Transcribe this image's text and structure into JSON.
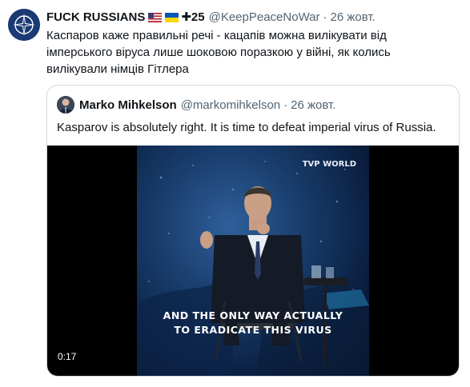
{
  "tweet": {
    "display_name": "FUCK RUSSIANS",
    "badges": [
      "us-flag",
      "ukraine-flag"
    ],
    "count_label": "✚25",
    "handle": "@KeepPeaceNoWar",
    "separator": "·",
    "timestamp": "26 жовт.",
    "text": "Каспаров каже правильні речі - кацапів можна вилікувати від імперського віруса лише шоковою поразкою у війні, як колись вилікували німців Гітлера"
  },
  "quoted_tweet": {
    "display_name": "Marko Mihkelson",
    "handle": "@markomihkelson",
    "separator": "·",
    "timestamp": "26 жовт.",
    "text": "Kasparov is absolutely right. It is time to defeat imperial virus of Russia."
  },
  "video": {
    "watermark": "TVP WORLD",
    "caption_line1": "AND THE ONLY WAY ACTUALLY",
    "caption_line2": "TO ERADICATE THIS VIRUS",
    "timecode": "0:17"
  },
  "colors": {
    "text": "#0f1419",
    "secondary": "#536471",
    "border": "#cfd9de",
    "nato_blue": "#1b3a73"
  },
  "icons": {
    "avatar": "nato-emblem-icon",
    "quoted_avatar": "profile-photo",
    "plus": "heavy-plus-icon"
  }
}
